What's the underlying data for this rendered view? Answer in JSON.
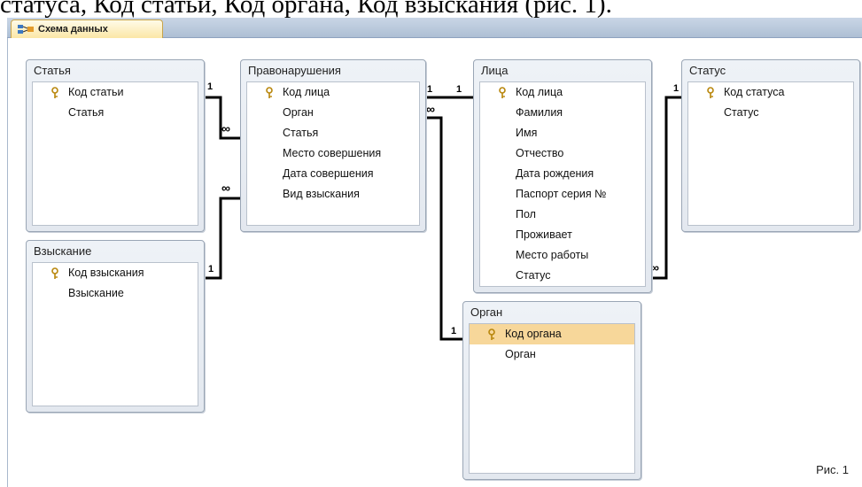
{
  "document": {
    "text": "статуса, Код статьи, Код органа, Код взыскания (рис. 1)."
  },
  "tab": {
    "label": "Схема данных",
    "icon": "relationships-icon"
  },
  "tables": {
    "statya": {
      "title": "Статья",
      "fields": [
        "Код статьи",
        "Статья"
      ]
    },
    "vzyskanie": {
      "title": "Взыскание",
      "fields": [
        "Код взыскания",
        "Взыскание"
      ]
    },
    "pravonarusheniya": {
      "title": "Правонарушения",
      "fields": [
        "Код лица",
        "Орган",
        "Статья",
        "Место совершения",
        "Дата совершения",
        "Вид взыскания"
      ]
    },
    "litsa": {
      "title": "Лица",
      "fields": [
        "Код лица",
        "Фамилия",
        "Имя",
        "Отчество",
        "Дата рождения",
        "Паспорт серия №",
        "Пол",
        "Проживает",
        "Место работы",
        "Статус"
      ]
    },
    "status": {
      "title": "Статус",
      "fields": [
        "Код статуса",
        "Статус"
      ]
    },
    "organ": {
      "title": "Орган",
      "fields": [
        "Код органа",
        "Орган"
      ]
    }
  },
  "relations": {
    "one": "1",
    "many": "∞"
  },
  "colors": {
    "selected_row": "#f7d79a",
    "tab": "#fbe7a6",
    "line": "#000000"
  },
  "footer": {
    "caption": "Рис. 1"
  }
}
